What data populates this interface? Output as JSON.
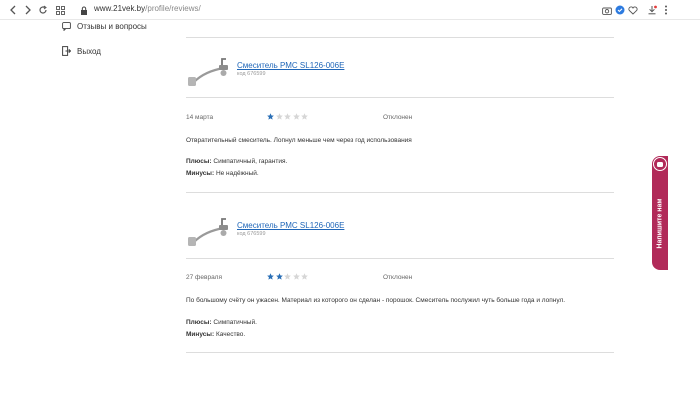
{
  "browser": {
    "url_host": "www.21vek.by",
    "url_path": "/profile/reviews/"
  },
  "sidebar": {
    "items": [
      {
        "label": "Отзывы и вопросы",
        "icon": "chat-question-icon"
      },
      {
        "label": "Выход",
        "icon": "logout-icon"
      }
    ]
  },
  "reviews": [
    {
      "product_name": "Смеситель РМС SL126-006E",
      "product_code": "код 676599",
      "date": "14 марта",
      "rating": 1,
      "rating_max": 5,
      "status": "Отклонен",
      "text": "Отвратительный смеситель. Лопнул меньше чем через год использования",
      "pros_label": "Плюсы:",
      "pros": "Симпатичный, гарантия.",
      "cons_label": "Минусы:",
      "cons": "Не надёжный."
    },
    {
      "product_name": "Смеситель РМС SL126-006E",
      "product_code": "код 676599",
      "date": "27 февраля",
      "rating": 2,
      "rating_max": 5,
      "status": "Отклонен",
      "text": "По большому счёту он ужасен. Материал из которого он сделан - порошок. Смеситель послужил чуть больше года и лопнул.",
      "pros_label": "Плюсы:",
      "pros": "Симпатичный.",
      "cons_label": "Минусы:",
      "cons": "Качество."
    }
  ],
  "side_tab": {
    "label": "Напишите нам"
  },
  "colors": {
    "star_filled": "#2a6fb6",
    "star_empty": "#d6d6d6",
    "accent": "#b12a59",
    "link": "#1f66b8"
  }
}
